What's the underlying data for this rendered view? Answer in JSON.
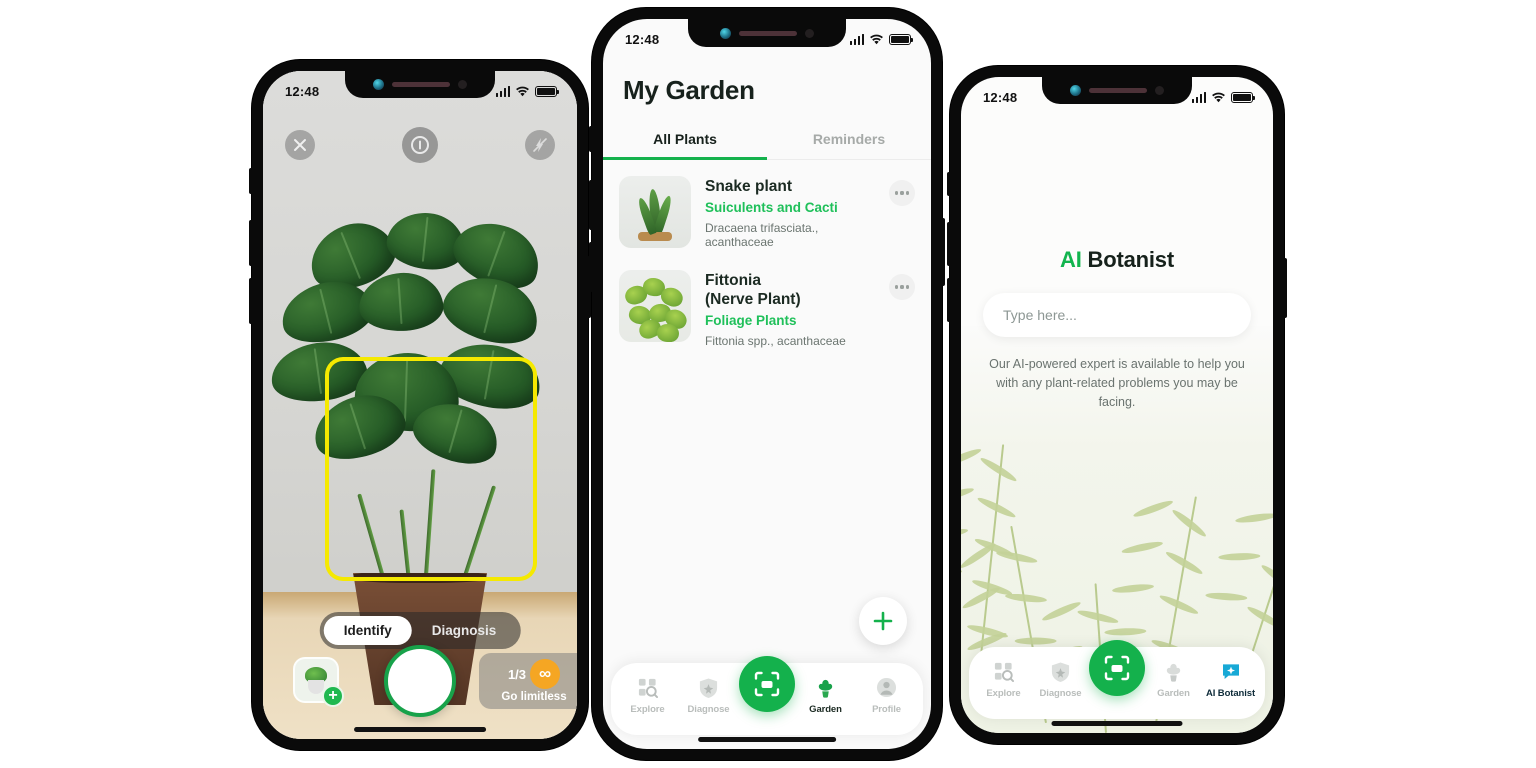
{
  "phones": {
    "camera": {
      "status": {
        "time": "12:48",
        "signal_icon": "cellular-signal-icon",
        "wifi_icon": "wifi-icon",
        "battery_icon": "battery-icon"
      },
      "top_controls": {
        "close_icon": "close-icon",
        "info_icon": "info-icon",
        "flash_off_icon": "flash-off-icon"
      },
      "scan_frame_color": "#f5e900",
      "modes": [
        {
          "label": "Identify",
          "active": true
        },
        {
          "label": "Diagnosis",
          "active": false
        }
      ],
      "gallery": {
        "name": "gallery-thumbnail",
        "badge": "+"
      },
      "shutter": {
        "name": "shutter-button",
        "ring_color": "#18a24a"
      },
      "limitless": {
        "count": "1/3",
        "icon": "infinity-icon",
        "label": "Go limitless",
        "icon_color": "#f5a623"
      }
    },
    "garden": {
      "status": {
        "time": "12:48"
      },
      "title": "My Garden",
      "tabs": [
        {
          "label": "All Plants",
          "active": true
        },
        {
          "label": "Reminders",
          "active": false
        }
      ],
      "plants": [
        {
          "name": "Snake plant",
          "category": "Suiculents and Cacti",
          "scientific": "Dracaena trifasciata., acanthaceae",
          "thumb": "snake-plant-thumbnail"
        },
        {
          "name": "Fittonia\n(Nerve Plant)",
          "category": "Foliage Plants",
          "scientific": "Fittonia spp., acanthaceae",
          "thumb": "fittonia-thumbnail"
        }
      ],
      "fab": {
        "name": "add-plant-button",
        "icon": "plus-icon",
        "color": "#14b14c"
      },
      "nav": [
        {
          "label": "Explore",
          "icon": "explore-icon",
          "active": false
        },
        {
          "label": "Diagnose",
          "icon": "diagnose-shield-icon",
          "active": false
        },
        {
          "label": "",
          "icon": "scan-icon",
          "active": false,
          "center": true
        },
        {
          "label": "Garden",
          "icon": "garden-plant-icon",
          "active": true
        },
        {
          "label": "Profile",
          "icon": "profile-avatar-icon",
          "active": false
        }
      ]
    },
    "ai": {
      "status": {
        "time": "12:48"
      },
      "title_accent": "AI",
      "title_rest": " Botanist",
      "input_placeholder": "Type here...",
      "description": "Our AI-powered expert is available to help you with any plant-related problems you may be facing.",
      "nav": [
        {
          "label": "Explore",
          "icon": "explore-icon",
          "active": false
        },
        {
          "label": "Diagnose",
          "icon": "diagnose-shield-icon",
          "active": false
        },
        {
          "label": "",
          "icon": "scan-icon",
          "active": false,
          "center": true
        },
        {
          "label": "Garden",
          "icon": "garden-plant-icon",
          "active": false
        },
        {
          "label": "AI Botanist",
          "icon": "ai-botanist-icon",
          "active": true
        }
      ]
    }
  },
  "colors": {
    "brand_green": "#14b14c",
    "accent_green": "#1fc05a",
    "scan_yellow": "#f5e900",
    "orange": "#f5a623",
    "ai_blue": "#17a9d6",
    "page_bg": "#ffffff"
  }
}
